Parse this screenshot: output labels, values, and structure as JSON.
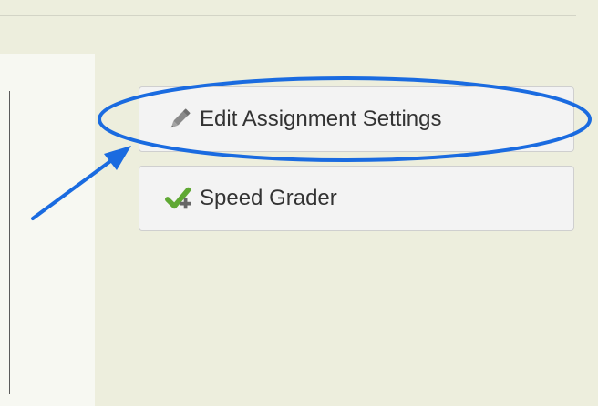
{
  "actions": {
    "edit_settings_label": "Edit Assignment Settings",
    "speed_grader_label": "Speed Grader"
  },
  "icons": {
    "edit": "pencil-icon",
    "grader": "checkmark-plus-icon"
  },
  "colors": {
    "background": "#edeedd",
    "panel": "#f7f8f2",
    "button": "#f3f3f3",
    "annotation": "#1a6be0",
    "check": "#5fa833",
    "pencil": "#8a8a8a"
  }
}
